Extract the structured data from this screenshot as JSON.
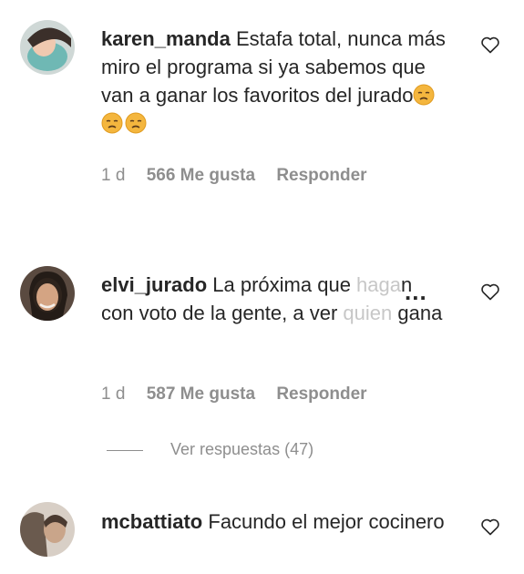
{
  "comments": [
    {
      "username": "karen_manda",
      "text": "Estafa total, nunca más miro el programa si ya sabemos que van a ganar los favoritos del jurado",
      "emoji_count": 3,
      "emoji_name": "pensive-face-emoji",
      "time": "1 d",
      "likes": "566 Me gusta",
      "reply": "Responder"
    },
    {
      "username": "elvi_jurado",
      "text_visible": "La próxima que ",
      "text_faded": "haga",
      "text_after": "n con voto de la gente, a ver ",
      "text_faded_2": "quien",
      "text_end": " gana",
      "more_indicator": "...",
      "time": "1 d",
      "likes": "587 Me gusta",
      "reply": "Responder",
      "view_replies": "Ver respuestas (47)"
    },
    {
      "username": "mcbattiato",
      "text": "Facundo el mejor cocinero"
    }
  ],
  "colors": {
    "text": "#262626",
    "secondary": "#8e8e8e",
    "emoji": "#f4b63e"
  },
  "icons": {
    "like": "heart-outline-icon"
  }
}
